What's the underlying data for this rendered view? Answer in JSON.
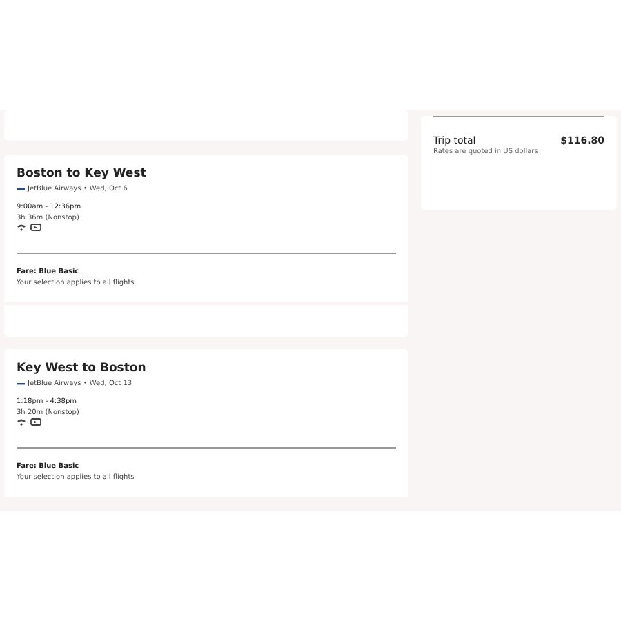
{
  "flights": [
    {
      "title": "Boston to Key West",
      "airline": "JetBlue Airways • Wed, Oct 6",
      "times": "9:00am - 12:36pm",
      "duration": "3h 36m (Nonstop)",
      "fare": "Fare: Blue Basic",
      "note": "Your selection applies to all flights"
    },
    {
      "title": "Key West to Boston",
      "airline": "JetBlue Airways • Wed, Oct 13",
      "times": "1:18pm - 4:38pm",
      "duration": "3h 20m (Nonstop)",
      "fare": "Fare: Blue Basic",
      "note": "Your selection applies to all flights"
    }
  ],
  "summary": {
    "total_label": "Trip total",
    "total": "$116.80",
    "note": "Rates are quoted in US dollars"
  }
}
